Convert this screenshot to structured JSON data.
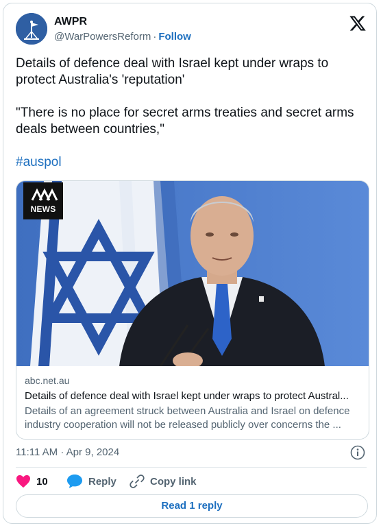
{
  "author": {
    "name": "AWPR",
    "handle": "@WarPowersReform",
    "separator": "·",
    "follow_label": "Follow"
  },
  "tweet": {
    "paragraph1": "Details of defence deal with Israel kept under wraps to protect Australia's 'reputation'",
    "paragraph2": "\"There is no place for secret arms treaties and secret arms deals between countries,\"",
    "hashtag": "#auspol"
  },
  "link_card": {
    "badge_text": "NEWS",
    "domain": "abc.net.au",
    "title": "Details of defence deal with Israel kept under wraps to protect Austral...",
    "description": "Details of an agreement struck between Australia and Israel on defence industry cooperation will not be released publicly over concerns the ..."
  },
  "timestamp": "11:11 AM · Apr 9, 2024",
  "actions": {
    "like_count": "10",
    "reply_label": "Reply",
    "copy_label": "Copy link"
  },
  "read_reply_label": "Read 1 reply",
  "icons": {
    "logo": "x-logo-icon",
    "info": "info-icon",
    "like": "heart-icon",
    "reply": "speech-bubble-icon",
    "copy": "link-icon"
  },
  "colors": {
    "accent": "#1d6fbf",
    "like": "#f91880",
    "reply": "#1d9bf0"
  }
}
